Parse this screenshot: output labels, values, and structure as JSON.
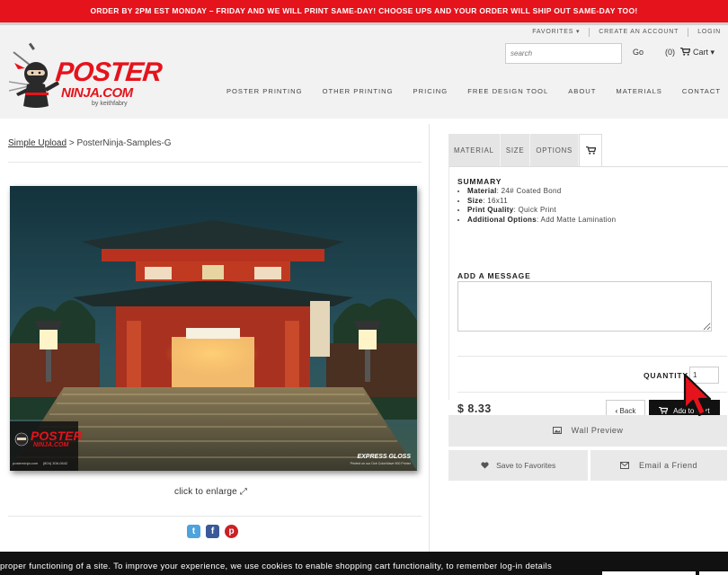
{
  "banner": {
    "text_1": "ORDER BY ",
    "text_2": "2PM EST MONDAY – FRIDAY",
    "text_3": " AND WE WILL PRINT SAME-DAY! CHOOSE UPS AND YOUR ORDER WILL SHIP OUT SAME-DAY TOO!"
  },
  "toplinks": {
    "favorites": "FAVORITES ▾",
    "create_account": "CREATE AN ACCOUNT",
    "login": "LOGIN"
  },
  "search": {
    "placeholder": "search",
    "go_label": "Go"
  },
  "cart": {
    "count": "(0)",
    "label": "Cart ▾"
  },
  "logo": {
    "line1": "POSTER",
    "line2": "NINJA.COM",
    "byline": "by keithfabry"
  },
  "nav": [
    "POSTER PRINTING",
    "OTHER PRINTING",
    "PRICING",
    "FREE DESIGN TOOL",
    "ABOUT",
    "MATERIALS",
    "CONTACT"
  ],
  "breadcrumb": {
    "link": "Simple Upload",
    "separator": " > ",
    "current": "PosterNinja-Samples-G"
  },
  "photo": {
    "logo_line1": "POSTER",
    "logo_line2": "NINJA.COM",
    "contact": "posterninja.com     (804) 306-0642",
    "finish": "EXPRESS GLOSS",
    "finish_sub": "Printed on our Océ ColorWave 900 Printer"
  },
  "enlarge": {
    "label": "click to enlarge ⤢"
  },
  "social": {
    "twitter": "t",
    "facebook": "f",
    "pinterest": "p"
  },
  "tabs": [
    "MATERIAL",
    "SIZE",
    "OPTIONS"
  ],
  "summary": {
    "heading": "SUMMARY",
    "items": [
      {
        "key": "Material",
        "value": ": 24# Coated Bond"
      },
      {
        "key": "Size",
        "value": ": 16x11"
      },
      {
        "key": "Print Quality",
        "value": ": Quick Print"
      },
      {
        "key": "Additional Options",
        "value": ": Add Matte Lamination"
      }
    ]
  },
  "message": {
    "heading": "ADD A MESSAGE"
  },
  "quantity": {
    "label": "QUANTITY",
    "value": "1"
  },
  "price": "$ 8.33",
  "buttons": {
    "back": "Back",
    "add_to_cart": "Add to Cart",
    "wall_preview": "Wall Preview",
    "save_favorites": "Save to Favorites",
    "email_friend": "Email a Friend"
  },
  "cookie": {
    "text": " proper functioning of a site. To improve your experience, we use cookies to enable shopping cart functionality, to remember log-in details"
  },
  "colors": {
    "brand_red": "#e5131c",
    "black": "#111111"
  }
}
